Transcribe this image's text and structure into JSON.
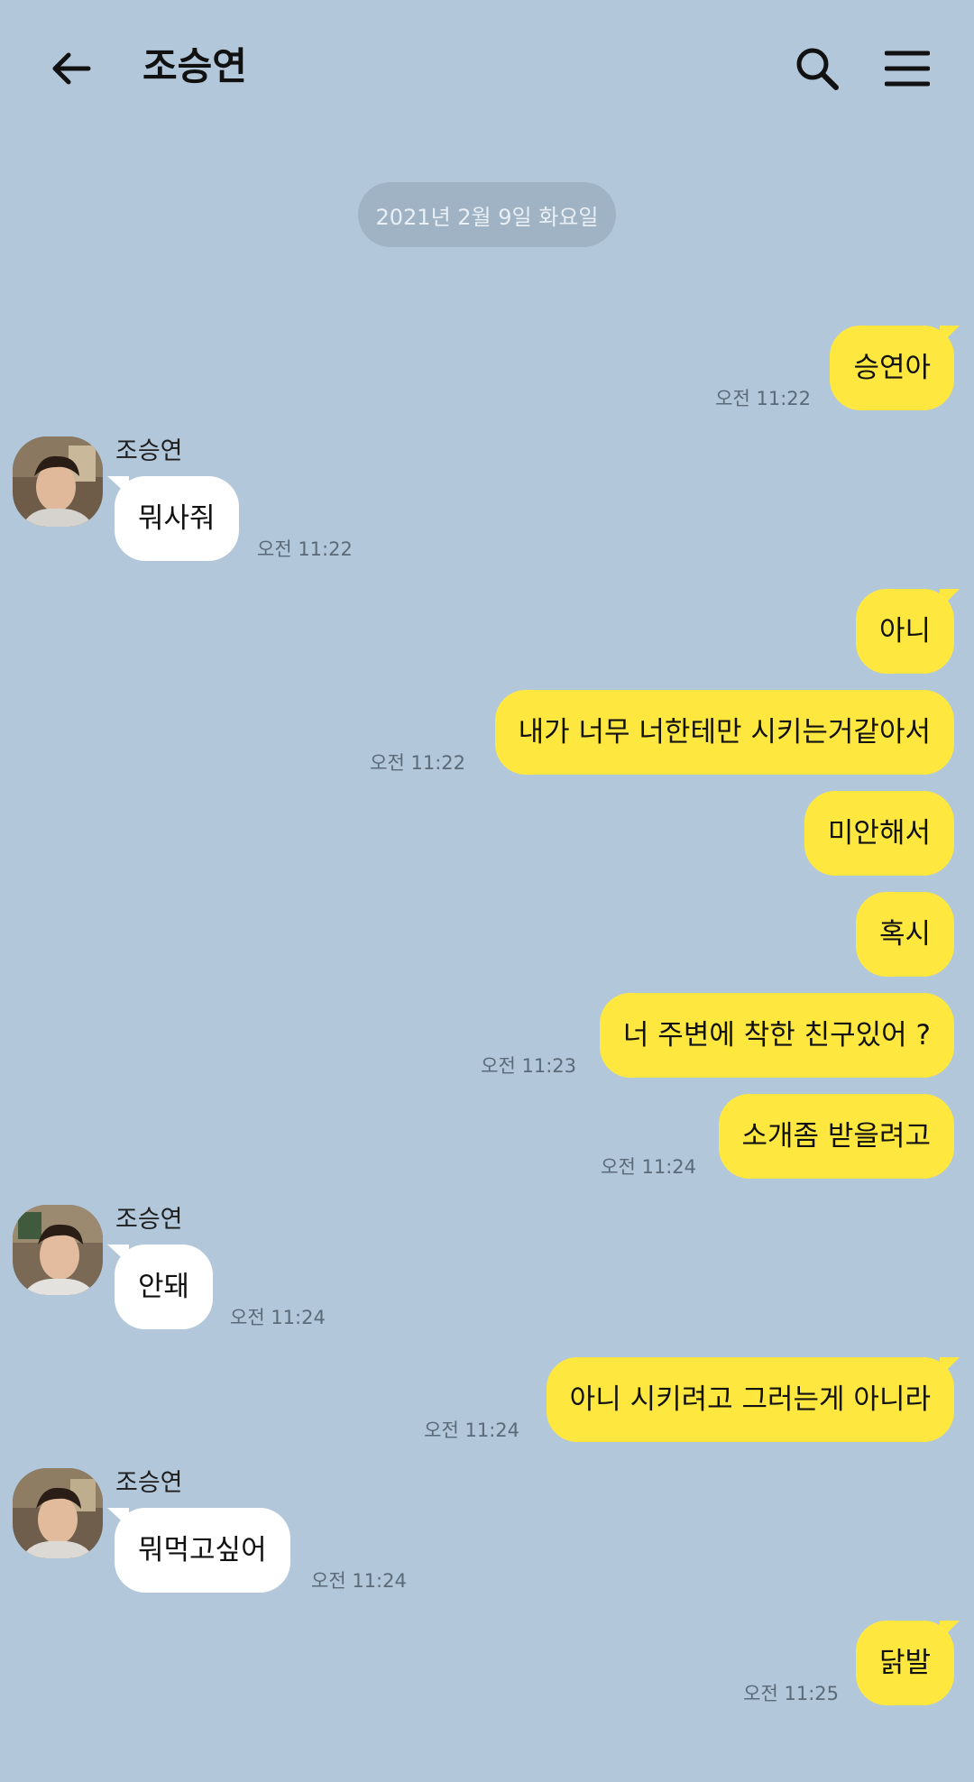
{
  "header": {
    "back_icon": "arrow-left-icon",
    "title": "조승연",
    "search_icon": "search-icon",
    "menu_icon": "hamburger-menu-icon"
  },
  "date_divider": "2021년 2월 9일 화요일",
  "messages": [
    {
      "from": "me",
      "text": "승연아",
      "time": "오전 11:22"
    },
    {
      "from": "them",
      "sender": "조승연",
      "text": "뭐사줘",
      "time": "오전 11:22"
    },
    {
      "from": "me",
      "text": "아니"
    },
    {
      "from": "me",
      "text": "내가 너무 너한테만 시키는거같아서",
      "time": "오전 11:22"
    },
    {
      "from": "me",
      "text": "미안해서"
    },
    {
      "from": "me",
      "text": "혹시"
    },
    {
      "from": "me",
      "text": "너 주변에 착한 친구있어 ?",
      "time": "오전 11:23"
    },
    {
      "from": "me",
      "text": "소개좀 받을려고",
      "time": "오전 11:24"
    },
    {
      "from": "them",
      "sender": "조승연",
      "text": "안돼",
      "time": "오전 11:24"
    },
    {
      "from": "me",
      "text": "아니 시키려고 그러는게 아니라",
      "time": "오전 11:24"
    },
    {
      "from": "them",
      "sender": "조승연",
      "text": "뭐먹고싶어",
      "time": "오전 11:24"
    },
    {
      "from": "me",
      "text": "닭발",
      "time": "오전 11:25"
    }
  ],
  "colors": {
    "background": "#b2c7da",
    "my_bubble": "#fee83f",
    "their_bubble": "#ffffff",
    "date_pill": "#9fb3c5"
  }
}
